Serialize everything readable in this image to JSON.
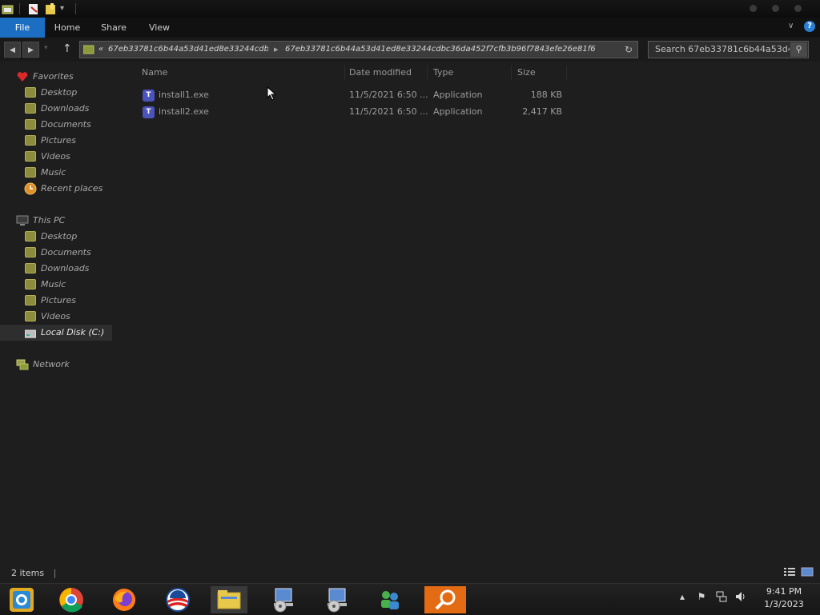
{
  "ribbon": {
    "tabs": [
      "File",
      "Home",
      "Share",
      "View"
    ]
  },
  "address": {
    "prefix": "«",
    "crumbs": [
      "67eb33781c6b44a53d41ed8e33244cdbc3...",
      "67eb33781c6b44a53d41ed8e33244cdbc36da452f7cfb3b96f7843efe26e81f6"
    ],
    "sep": "▶"
  },
  "search": {
    "placeholder": "Search 67eb33781c6b44a53d4..."
  },
  "sidebar": {
    "favorites": {
      "label": "Favorites",
      "items": [
        "Desktop",
        "Downloads",
        "Documents",
        "Pictures",
        "Videos",
        "Music",
        "Recent places"
      ]
    },
    "this_pc": {
      "label": "This PC",
      "items": [
        "Desktop",
        "Documents",
        "Downloads",
        "Music",
        "Pictures",
        "Videos",
        "Local Disk (C:)"
      ]
    },
    "network": {
      "label": "Network"
    }
  },
  "columns": {
    "name": "Name",
    "date": "Date modified",
    "type": "Type",
    "size": "Size"
  },
  "files": [
    {
      "name": "install1.exe",
      "date": "11/5/2021 6:50 ...",
      "type": "Application",
      "size": "188 KB"
    },
    {
      "name": "install2.exe",
      "date": "11/5/2021 6:50 ...",
      "type": "Application",
      "size": "2,417 KB"
    }
  ],
  "status": {
    "items": "2 items"
  },
  "clock": {
    "time": "9:41 PM",
    "date": "1/3/2023"
  },
  "icons": {
    "favorites": "heart-icon",
    "this_pc": "computer-icon",
    "network": "network-icon",
    "file": "teams-app-icon"
  },
  "colors": {
    "file_tab": "#1b6ec2",
    "background": "#1e1e1e",
    "favorites_heart": "#d82a2a"
  }
}
